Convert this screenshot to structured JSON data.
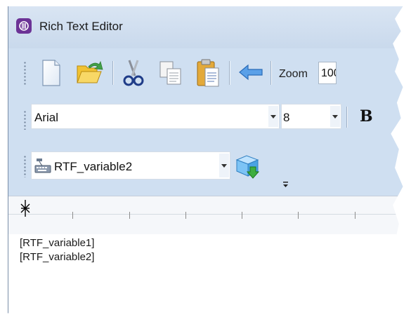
{
  "window": {
    "title": "Rich Text Editor"
  },
  "toolbar": {
    "buttons": [
      {
        "name": "new-document-icon",
        "label": "New"
      },
      {
        "name": "open-folder-icon",
        "label": "Open"
      },
      {
        "name": "cut-icon",
        "label": "Cut"
      },
      {
        "name": "copy-icon",
        "label": "Copy"
      },
      {
        "name": "paste-icon",
        "label": "Paste"
      },
      {
        "name": "undo-icon",
        "label": "Undo"
      }
    ],
    "zoom_label": "Zoom",
    "zoom_value": "100"
  },
  "format_bar": {
    "font": "Arial",
    "size": "8",
    "bold_label": "B"
  },
  "variable_bar": {
    "selected": "RTF_variable2",
    "icon": "variable-icon"
  },
  "editor": {
    "lines": [
      "[RTF_variable1]",
      "[RTF_variable2]"
    ]
  },
  "colors": {
    "toolbar_bg": "#cfdff1",
    "titlebar_bg": "#d9e5f3",
    "app_icon": "#6c3396"
  }
}
